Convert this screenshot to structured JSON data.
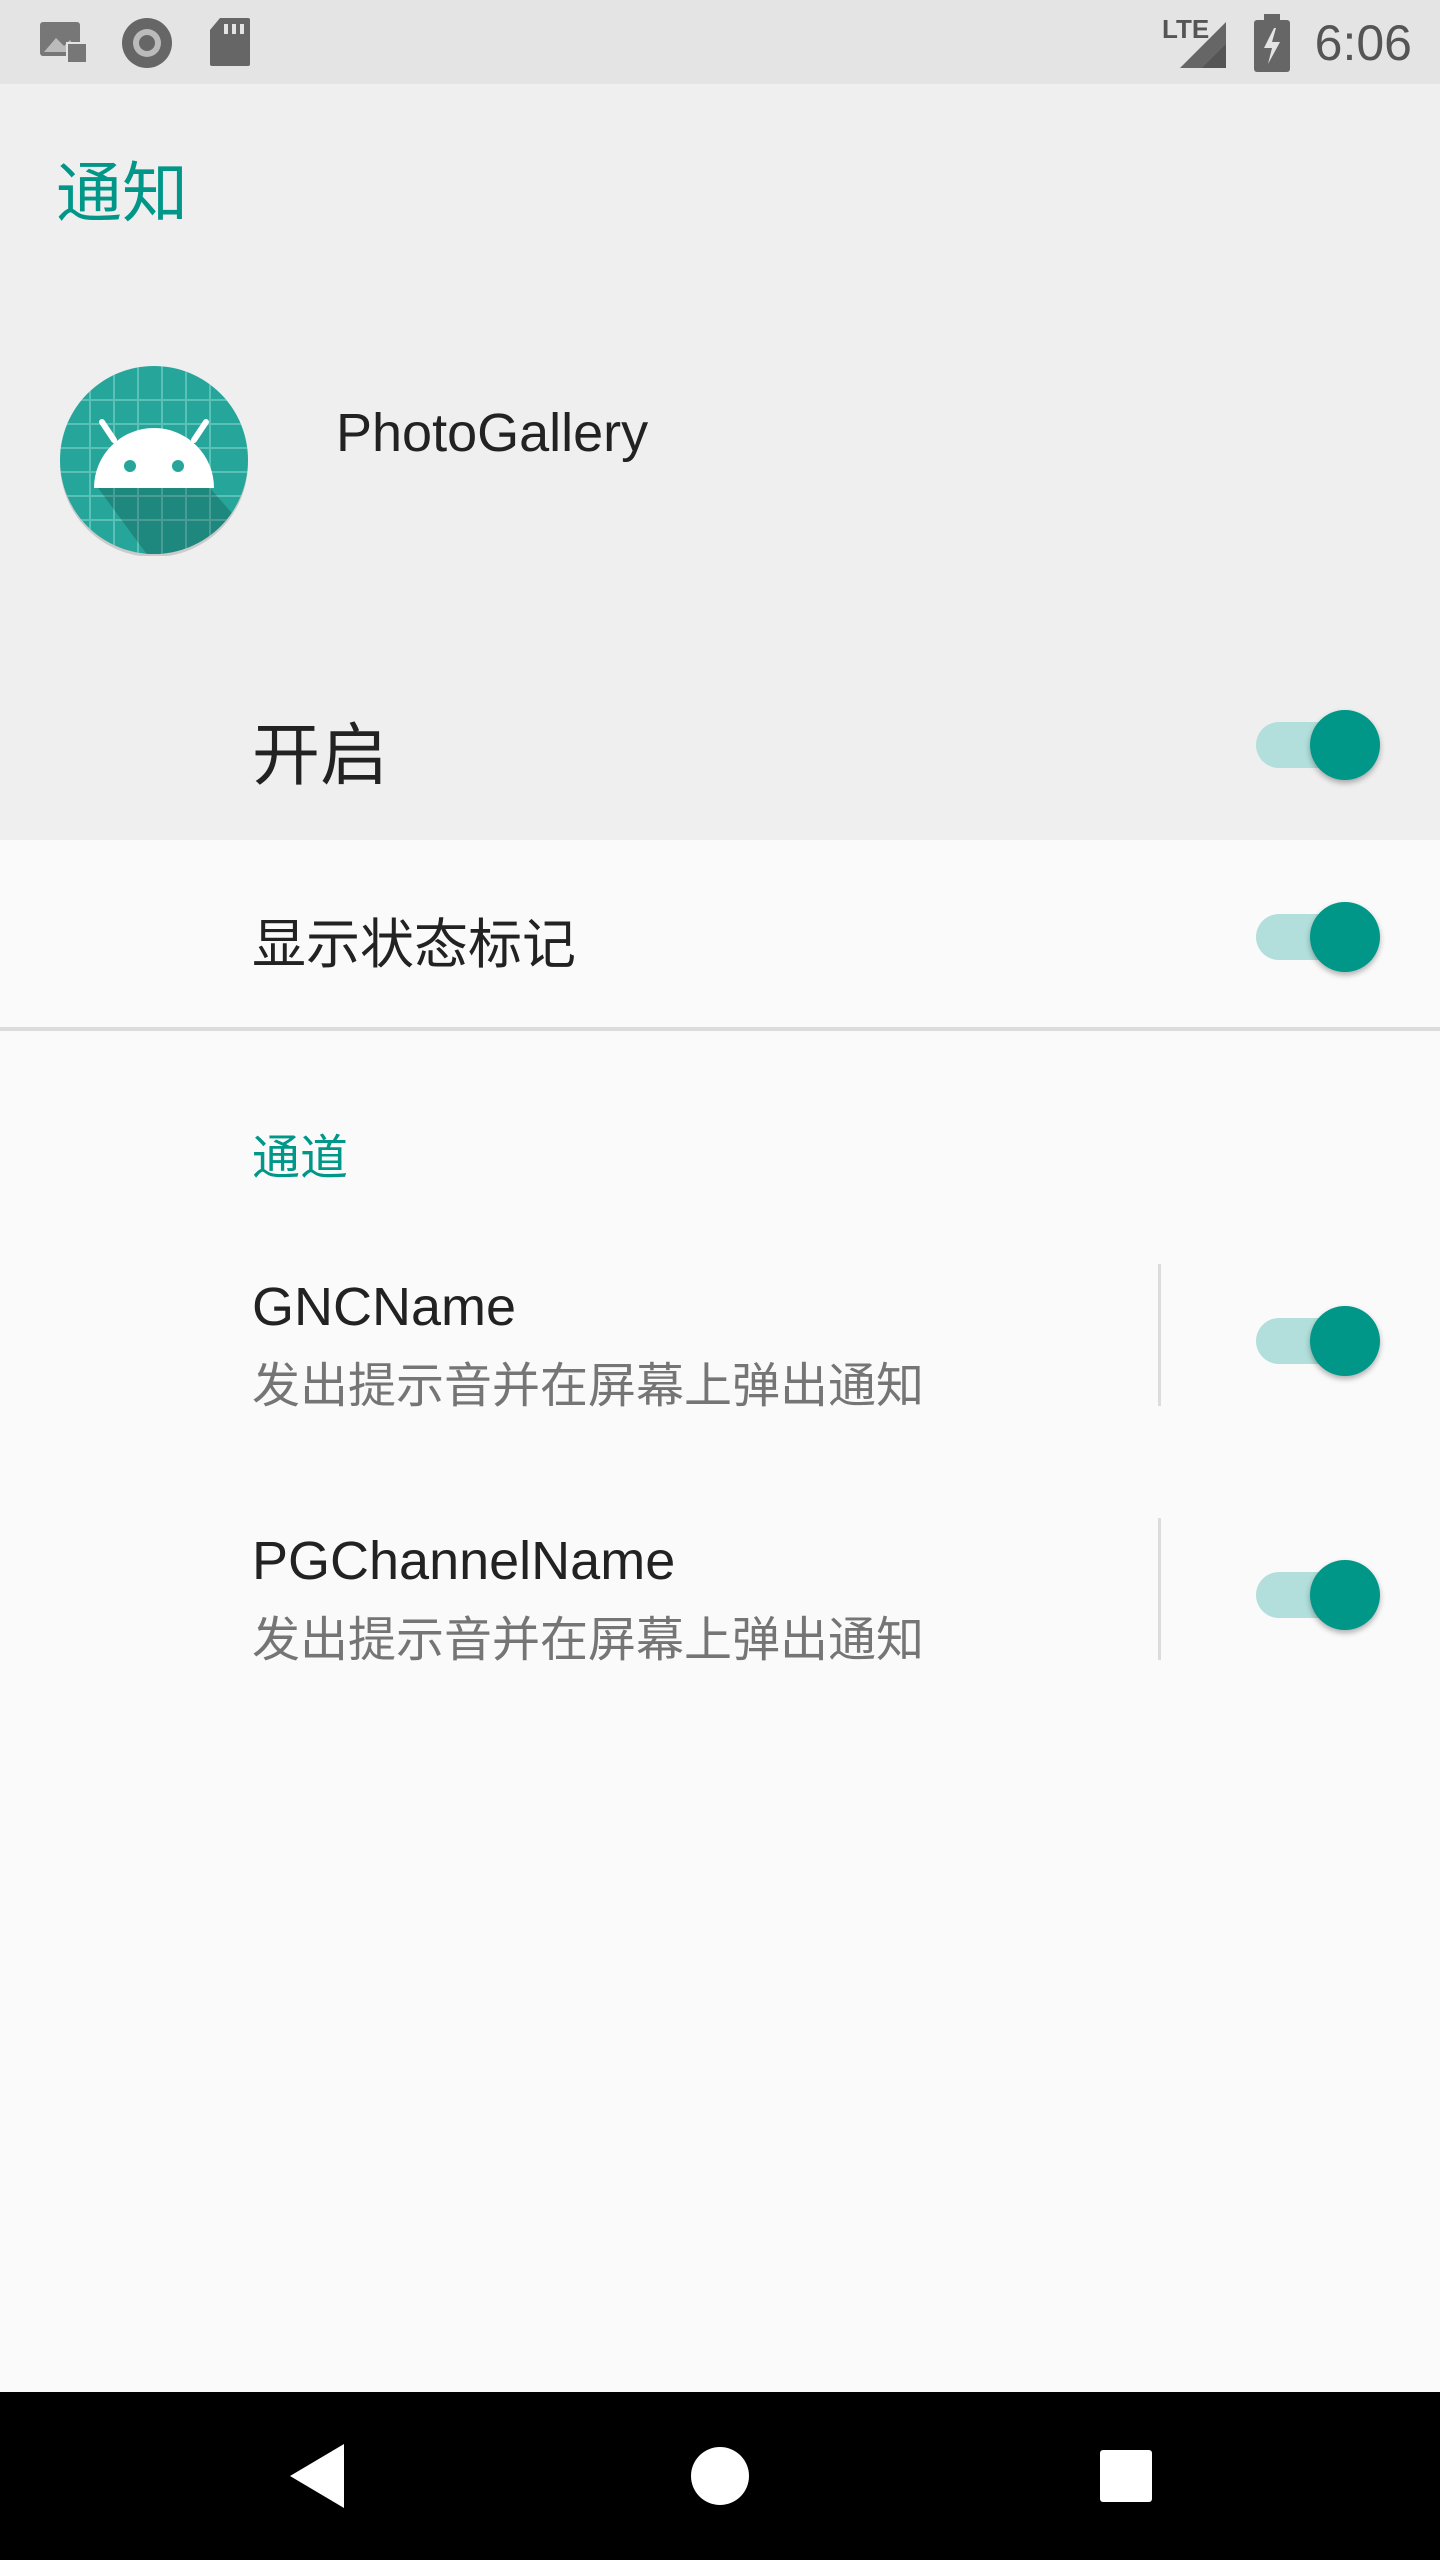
{
  "status_bar": {
    "time": "6:06",
    "network": "LTE",
    "icons": [
      "image-icon",
      "sync-circle-icon",
      "sd-card-icon",
      "signal-icon",
      "battery-charging-icon"
    ]
  },
  "header": {
    "title": "通知",
    "app_name": "PhotoGallery",
    "app_icon": "android-robot-icon"
  },
  "settings": {
    "enable_label": "开启",
    "enable_on": true,
    "badge_label": "显示状态标记",
    "badge_on": true
  },
  "channels": {
    "section_title": "通道",
    "items": [
      {
        "name": "GNCName",
        "description": "发出提示音并在屏幕上弹出通知",
        "enabled": true
      },
      {
        "name": "PGChannelName",
        "description": "发出提示音并在屏幕上弹出通知",
        "enabled": true
      }
    ]
  },
  "nav_bar": {
    "icons": [
      "back-icon",
      "home-icon",
      "recents-icon"
    ]
  },
  "colors": {
    "accent": "#009688",
    "accent_light": "#b2dfdb"
  }
}
